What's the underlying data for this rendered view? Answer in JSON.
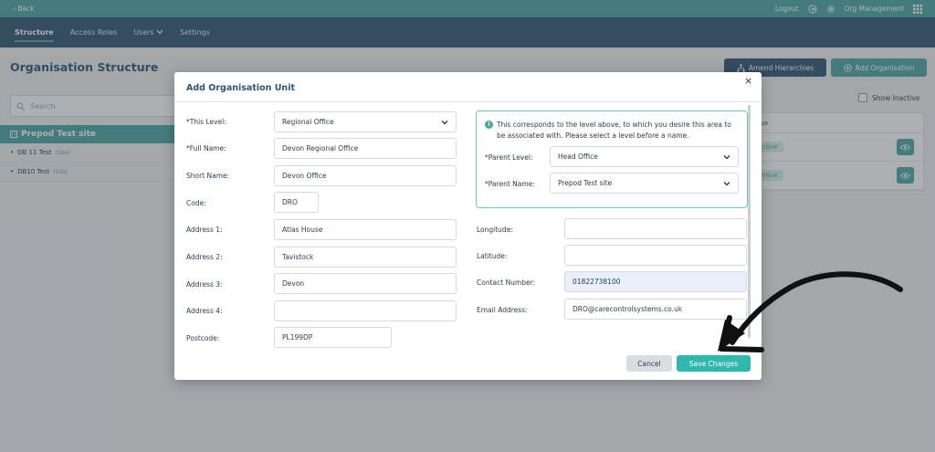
{
  "topbar": {
    "back_label": "Back",
    "logout_label": "Logout",
    "org_management_label": "Org Management"
  },
  "navbar": {
    "tabs": [
      {
        "label": "Structure",
        "active": true
      },
      {
        "label": "Access Roles"
      },
      {
        "label": "Users"
      },
      {
        "label": "Settings"
      }
    ]
  },
  "page": {
    "title": "Organisation Structure",
    "amend_hierarchies_label": "Amend Hierarchies",
    "add_organisation_label": "Add Organisation",
    "search_placeholder": "Search",
    "show_inactive_label": "Show Inactive",
    "tree": {
      "root": "Prepod Test site",
      "items": [
        {
          "label": "DB 11 Test",
          "tag": "(Site)"
        },
        {
          "label": "DB10 Test",
          "tag": "(Site)"
        }
      ]
    },
    "table": {
      "header_partial": "us",
      "rows": [
        {
          "status": "ctive"
        },
        {
          "status": "ctive"
        }
      ]
    }
  },
  "modal": {
    "title": "Add Organisation Unit",
    "close_glyph": "×",
    "fields": {
      "this_level": {
        "label": "*This Level:",
        "value": "Regional Office"
      },
      "full_name": {
        "label": "*Full Name:",
        "value": "Devon Regional Office"
      },
      "short_name": {
        "label": "Short Name:",
        "value": "Devon Office"
      },
      "code": {
        "label": "Code:",
        "value": "DRO"
      },
      "address1": {
        "label": "Address 1:",
        "value": "Atlas House"
      },
      "address2": {
        "label": "Address 2:",
        "value": "Tavistock"
      },
      "address3": {
        "label": "Address 3:",
        "value": "Devon"
      },
      "address4": {
        "label": "Address 4:",
        "value": ""
      },
      "postcode": {
        "label": "Postcode:",
        "value": "PL199DP"
      },
      "longitude": {
        "label": "Longitude:",
        "value": ""
      },
      "latitude": {
        "label": "Latitude:",
        "value": ""
      },
      "contact_number": {
        "label": "Contact Number:",
        "value": "01822738100"
      },
      "email_address": {
        "label": "Email Address:",
        "value": "DRO@carecontrolsystems.co.uk"
      }
    },
    "info": {
      "text": "This corresponds to the level above, to which you desire this area to be associated with. Please select a level before a name.",
      "parent_level": {
        "label": "*Parent Level:",
        "value": "Head Office"
      },
      "parent_name": {
        "label": "*Parent Name:",
        "value": "Prepod Test site"
      }
    },
    "buttons": {
      "cancel": "Cancel",
      "save": "Save Changes"
    }
  },
  "colors": {
    "teal": "#4aa6a4",
    "navy": "#2f5472",
    "save": "#2fb8ad"
  }
}
